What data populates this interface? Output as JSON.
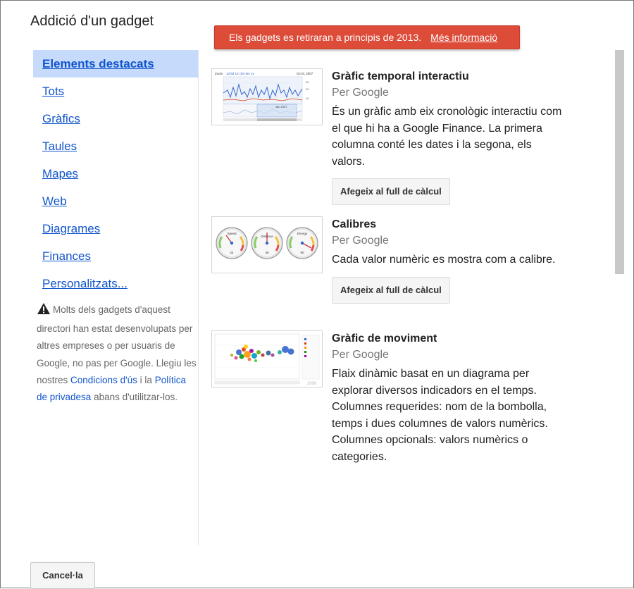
{
  "dialog": {
    "title": "Addició d'un gadget"
  },
  "banner": {
    "message": "Els gadgets es retiraran a principis de 2013.",
    "link": "Més informació",
    "color": "#dd4b39"
  },
  "sidebar": {
    "items": [
      {
        "label": "Elements destacats",
        "selected": true
      },
      {
        "label": "Tots"
      },
      {
        "label": "Gràfics"
      },
      {
        "label": "Taules"
      },
      {
        "label": "Mapes"
      },
      {
        "label": "Web"
      },
      {
        "label": "Diagrames"
      },
      {
        "label": "Finances"
      },
      {
        "label": "Personalitzats..."
      }
    ],
    "note": {
      "icon": "warning-icon",
      "text1": "Molts dels gadgets d'aquest directori han estat desenvolupats per altres empreses o per usuaris de Google, no pas per Google. Llegiu les nostres ",
      "link_terms": "Condicions d'ús",
      "text2": " i la ",
      "link_privacy": "Política de privadesa",
      "text3": " abans d'utilitzar-los."
    }
  },
  "gadgets": [
    {
      "title": "Gràfic temporal interactiu",
      "author": "Per Google",
      "description": "És un gràfic amb eix cronològic interactiu com el que hi ha a Google Finance. La primera columna conté les dates i la segona, els valors.",
      "button": "Afegeix al full de càlcul",
      "thumbnail": "annotated-timeline-thumbnail",
      "thumb_text": {
        "zoom": "Zoom",
        "date": "Oct 6, 2007",
        "range": "Jan 2007",
        "y1": "30",
        "y2": "20",
        "y3": "10"
      }
    },
    {
      "title": "Calibres",
      "author": "Per Google",
      "description": "Cada valor numèric es mostra com a calibre.",
      "button": "Afegeix al full de càlcul",
      "thumbnail": "gauges-thumbnail",
      "thumb_text": {
        "g1": "Speed",
        "g2": "Distance",
        "g3": "Energy",
        "v1": "24",
        "v2": "45",
        "v3": "90"
      }
    },
    {
      "title": "Gràfic de moviment",
      "author": "Per Google",
      "description": "Flaix dinàmic basat en un diagrama per explorar diversos indicadors en el temps. Columnes requerides: nom de la bombolla, temps i dues columnes de valors numèrics. Columnes opcionals: valors numèrics o categories.",
      "thumbnail": "motion-chart-thumbnail",
      "thumb_text": {
        "year": "2006"
      }
    }
  ],
  "footer": {
    "cancel": "Cancel·la"
  }
}
